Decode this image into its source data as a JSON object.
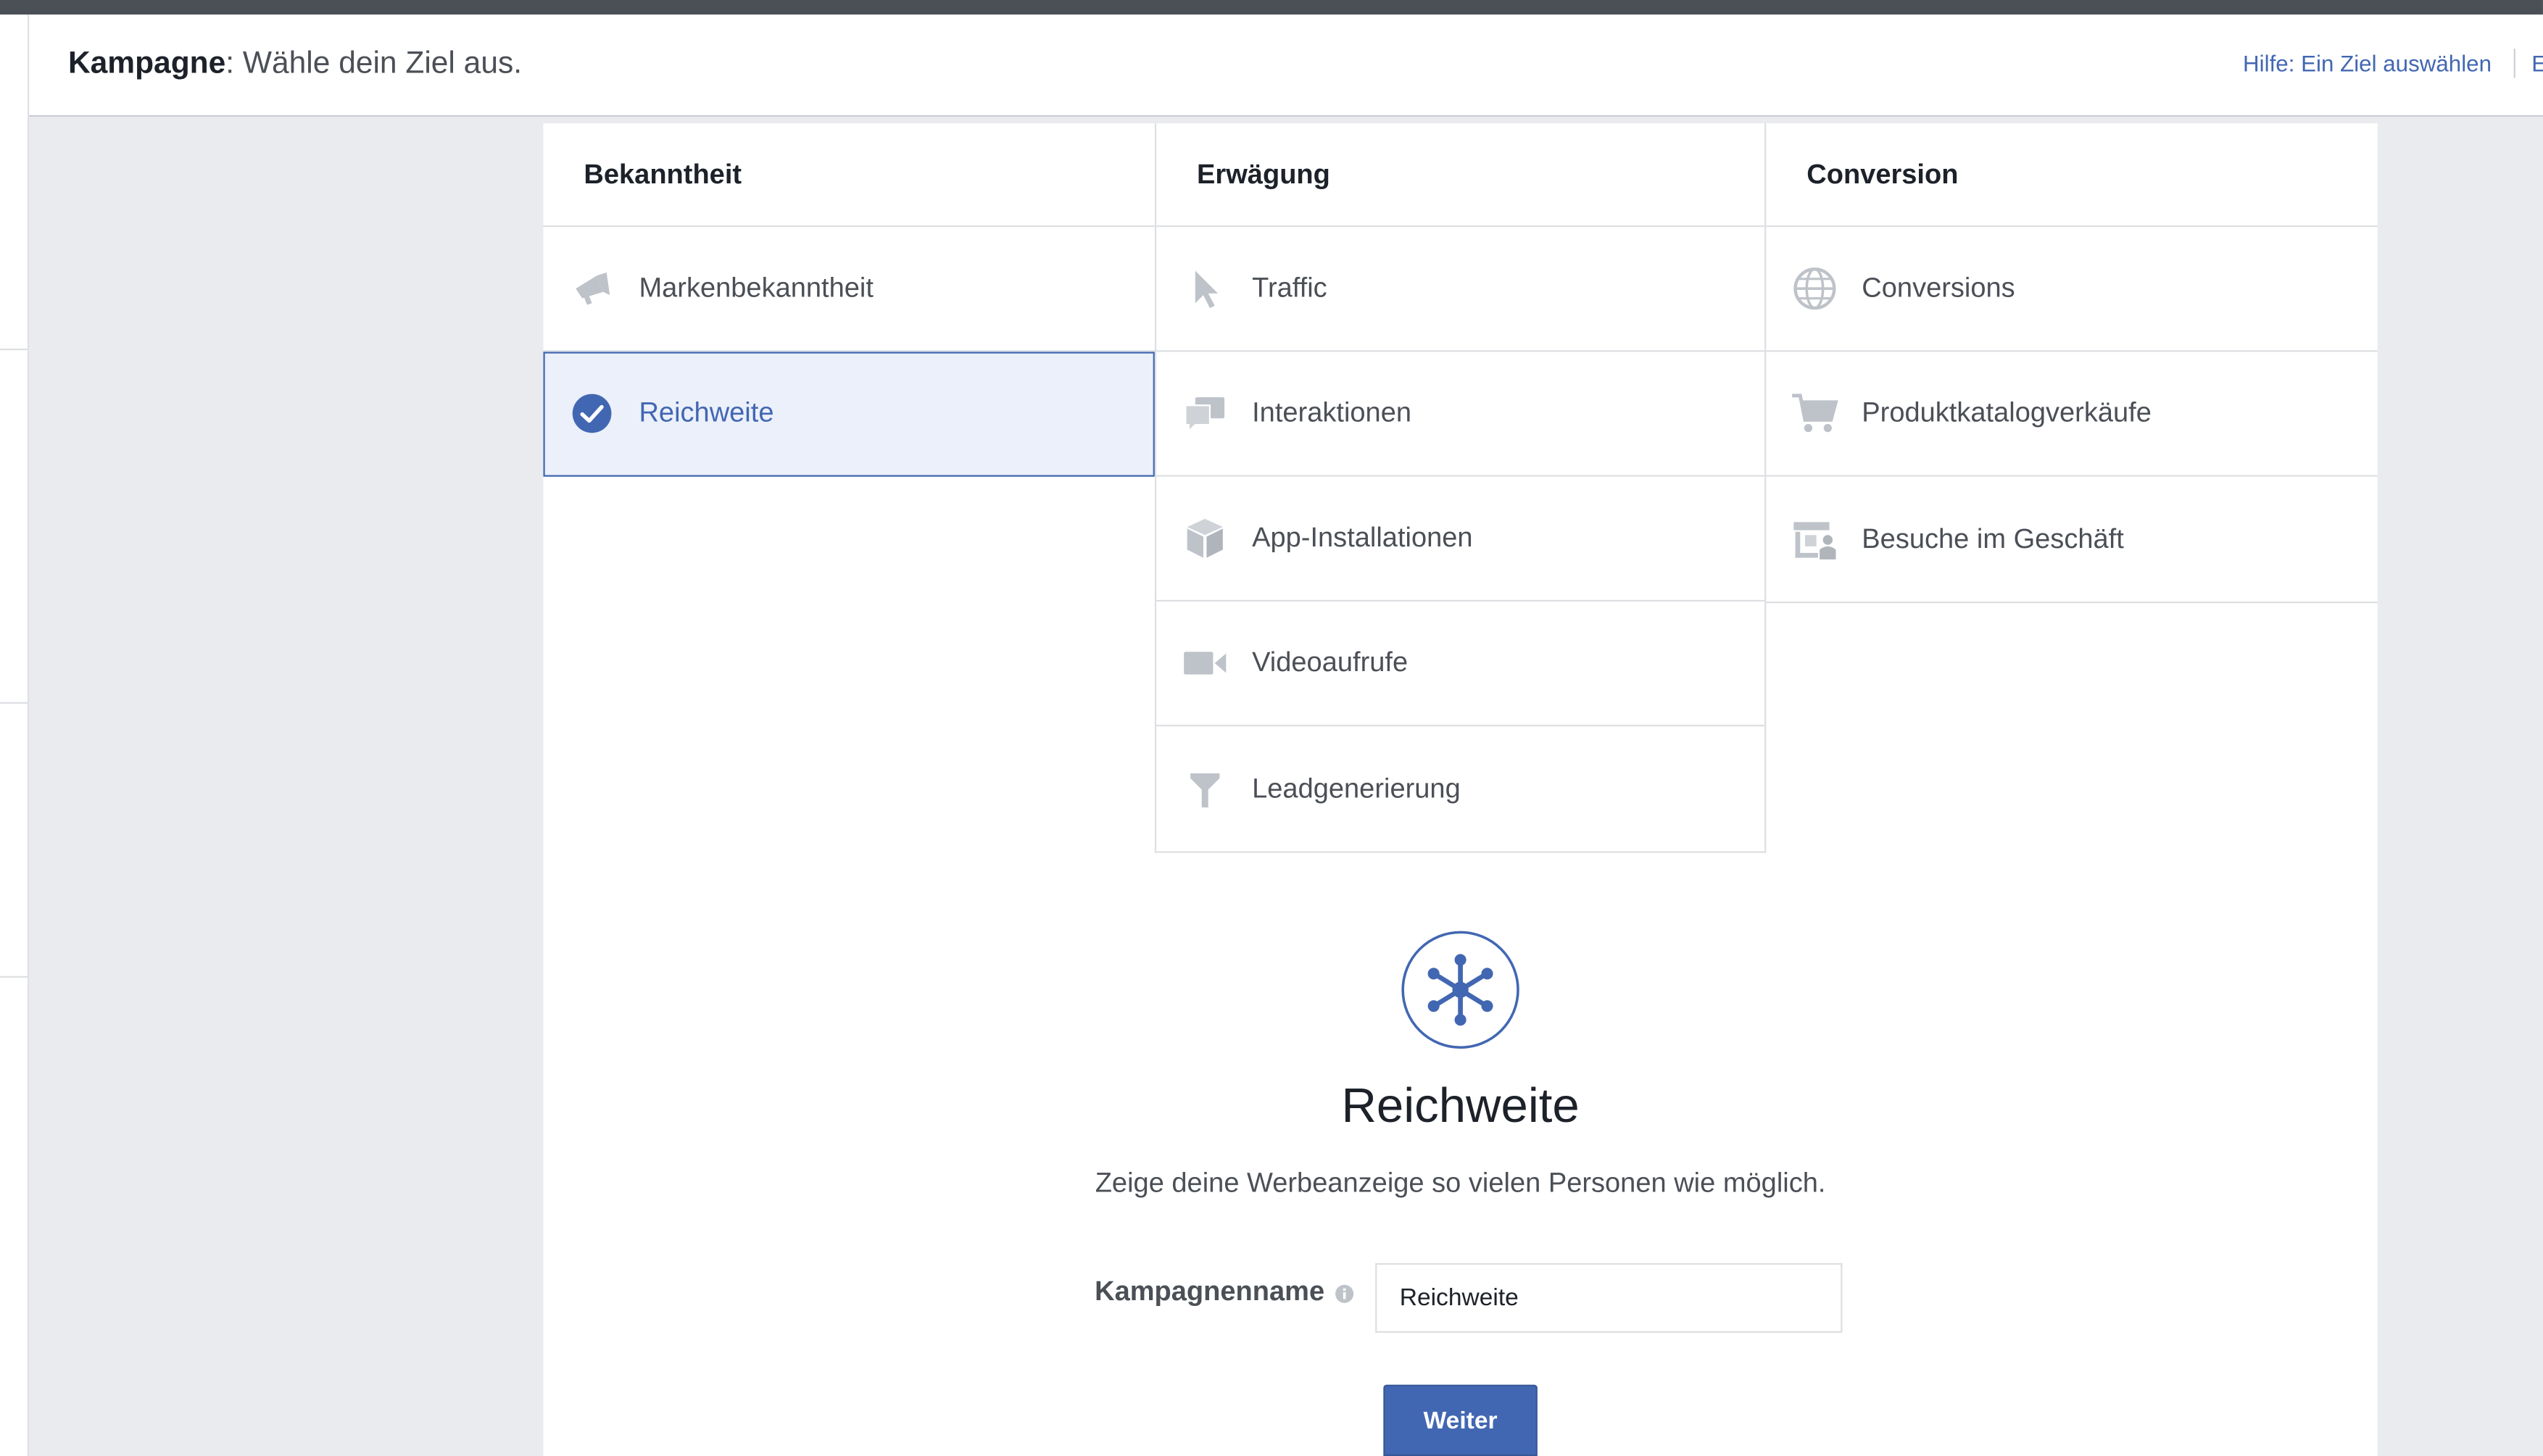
{
  "header": {
    "title_bold": "Kampagne",
    "title_rest": ": Wähle dein Ziel aus.",
    "help_link": "Hilfe: Ein Ziel auswählen",
    "more_link": "E"
  },
  "columns": [
    {
      "heading": "Bekanntheit",
      "items": [
        {
          "label": "Markenbekanntheit",
          "icon": "megaphone-icon",
          "selected": false
        },
        {
          "label": "Reichweite",
          "icon": "checkmark-circle-icon",
          "selected": true
        }
      ]
    },
    {
      "heading": "Erwägung",
      "items": [
        {
          "label": "Traffic",
          "icon": "cursor-icon",
          "selected": false
        },
        {
          "label": "Interaktionen",
          "icon": "chat-bubbles-icon",
          "selected": false
        },
        {
          "label": "App-Installationen",
          "icon": "box-icon",
          "selected": false
        },
        {
          "label": "Videoaufrufe",
          "icon": "video-camera-icon",
          "selected": false
        },
        {
          "label": "Leadgenerierung",
          "icon": "funnel-icon",
          "selected": false
        }
      ]
    },
    {
      "heading": "Conversion",
      "items": [
        {
          "label": "Conversions",
          "icon": "globe-icon",
          "selected": false
        },
        {
          "label": "Produktkatalogverkäufe",
          "icon": "shopping-cart-icon",
          "selected": false
        },
        {
          "label": "Besuche im Geschäft",
          "icon": "store-icon",
          "selected": false
        }
      ]
    }
  ],
  "detail": {
    "icon": "reach-network-icon",
    "title": "Reichweite",
    "description": "Zeige deine Werbeanzeige so vielen Personen wie möglich.",
    "name_label": "Kampagnenname",
    "name_value": "Reichweite",
    "next_button": "Weiter"
  },
  "colors": {
    "accent": "#4267b2",
    "selected_bg": "#ebf0fa",
    "icon_gray": "#bec3c9",
    "page_bg": "#e9ebee"
  }
}
